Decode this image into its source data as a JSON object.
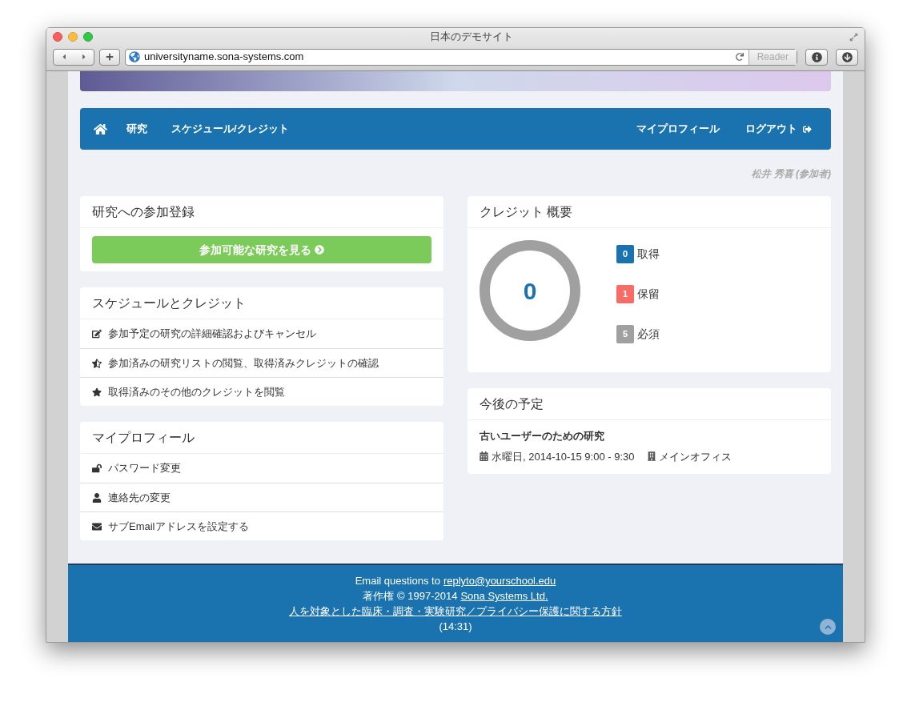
{
  "browser": {
    "title": "日本のデモサイト",
    "url": "universityname.sona-systems.com",
    "reader_button": "Reader"
  },
  "nav": {
    "left": [
      {
        "kind": "home"
      },
      {
        "kind": "link",
        "label": "研究"
      },
      {
        "kind": "link",
        "label": "スケジュール/クレジット"
      }
    ],
    "right": [
      {
        "kind": "link",
        "label": "マイプロフィール"
      },
      {
        "kind": "logout",
        "label": "ログアウト"
      }
    ]
  },
  "user": "松井 秀喜 (参加者)",
  "signup_panel": {
    "title": "研究への参加登録",
    "button": "参加可能な研究を見る"
  },
  "schedule_panel": {
    "title": "スケジュールとクレジット",
    "items": [
      {
        "kind": "edit",
        "label": "参加予定の研究の詳細確認およびキャンセル"
      },
      {
        "kind": "half-star",
        "label": "参加済みの研究リストの閲覧、取得済みクレジットの確認"
      },
      {
        "kind": "star",
        "label": "取得済みのその他のクレジットを閲覧"
      }
    ]
  },
  "profile_panel": {
    "title": "マイプロフィール",
    "items": [
      {
        "kind": "unlock",
        "label": "パスワード変更"
      },
      {
        "kind": "user",
        "label": "連絡先の変更"
      },
      {
        "kind": "envelope",
        "label": "サブEmailアドレスを設定する"
      }
    ]
  },
  "credits_panel": {
    "title": "クレジット 概要",
    "total": "0",
    "legend": [
      {
        "count": "0",
        "label": "取得",
        "color": "#1a73af"
      },
      {
        "count": "1",
        "label": "保留",
        "color": "#f76c64"
      },
      {
        "count": "5",
        "label": "必須",
        "color": "#a0a0a0"
      }
    ]
  },
  "upcoming_panel": {
    "title": "今後の予定",
    "study": "古いユーザーのための研究",
    "when": "水曜日, 2014-10-15 9:00 - 9:30",
    "where": "メインオフィス"
  },
  "footer": {
    "email_prefix": "Email questions to",
    "email": "replyto@yourschool.edu",
    "copyright_prefix": "著作権 © 1997-2014",
    "company": "Sona Systems Ltd.",
    "policy": "人を対象とした臨床・調査・実験研究／プライバシー保護に関する方針",
    "time": "(14:31)"
  }
}
